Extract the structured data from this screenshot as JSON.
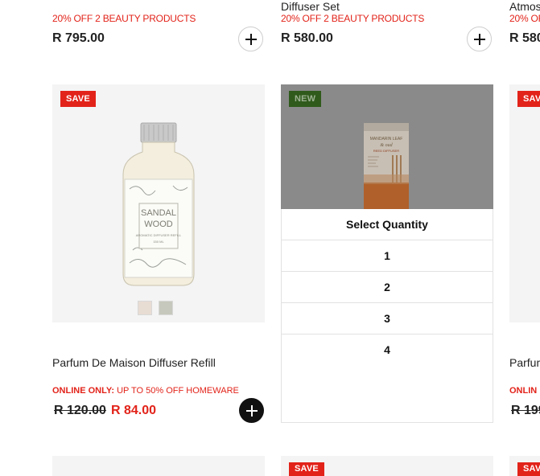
{
  "top_row": {
    "col1": {
      "promo": "20% OFF 2 BEAUTY PRODUCTS",
      "price": "R 795.00"
    },
    "col2": {
      "title": "Diffuser Set",
      "promo": "20% OFF 2 BEAUTY PRODUCTS",
      "price": "R 580.00"
    },
    "col3": {
      "title": "Atmos",
      "promo": "20% OFF",
      "price": "R 580"
    }
  },
  "middle_row": {
    "card1": {
      "badge": "SAVE",
      "label_line1": "SANDAL",
      "label_line2": "WOOD",
      "label_line3": "AROMATIC DIFFUSER REFILL",
      "label_line4": "150 ML",
      "swatches": [
        "#e8ddd3",
        "#c7c8bd"
      ],
      "title": "Parfum De Maison Diffuser Refill",
      "online_label": "ONLINE ONLY:",
      "online_text": "UP TO 50% OFF HOMEWARE",
      "old_price": "R 120.00",
      "sale_price": "R 84.00"
    },
    "card2": {
      "badge": "NEW",
      "label_line1": "MANDARIN LEAF",
      "label_line2": "& oud",
      "label_line3": "REED DIFFUSER",
      "quantity_selector": {
        "heading": "Select Quantity",
        "options": [
          "1",
          "2",
          "3",
          "4"
        ]
      }
    },
    "card3": {
      "badge": "SAVE",
      "title": "Parfum",
      "online_label": "ONLIN",
      "old_price": "R 199"
    }
  },
  "bottom_row": {
    "card2_badge": "SAVE",
    "card3_badge": "SAVE"
  },
  "colors": {
    "accent_red": "#e2231a",
    "new_green": "#3b7a22",
    "image_bg": "#f4f4f4"
  }
}
